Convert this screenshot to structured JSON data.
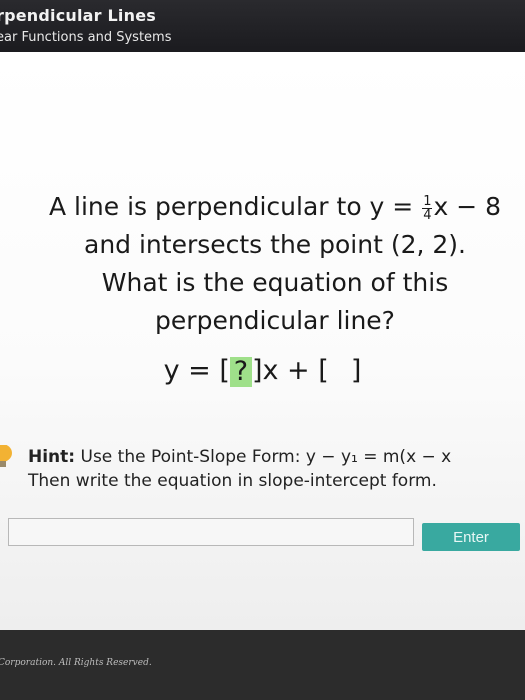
{
  "header": {
    "title": "rpendicular Lines",
    "subtitle": "ear Functions and Systems"
  },
  "question": {
    "line1_prefix": "A line is perpendicular to y = ",
    "frac_num": "1",
    "frac_den": "4",
    "line1_suffix": "x − 8",
    "line2": "and intersects the point (2, 2).",
    "line3": "What is the equation of this",
    "line4": "perpendicular line?"
  },
  "equation": {
    "prefix": "y = ",
    "slope_box": "?",
    "middle": "x + ",
    "intercept_box": ""
  },
  "hint": {
    "label": "Hint:",
    "line1": " Use the Point-Slope Form: y − y₁ = m(x − x",
    "line2": "Then write the equation in slope-intercept form."
  },
  "answer": {
    "value": ""
  },
  "enter_label": "Enter",
  "footer_text": "Corporation. All Rights Reserved.",
  "colors": {
    "accent_button": "#39a9a0",
    "active_box": "#9fe08a",
    "hint_icon": "#f2b233"
  },
  "icons": {
    "hint": "lightbulb-icon"
  }
}
